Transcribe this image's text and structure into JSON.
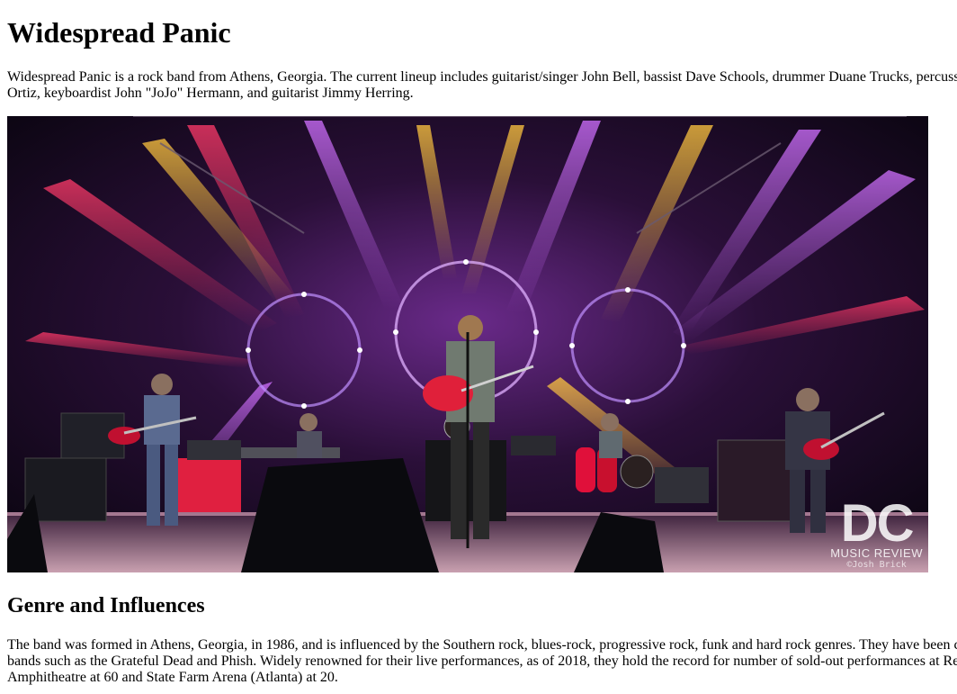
{
  "article": {
    "title": "Widespread Panic",
    "intro": "Widespread Panic is a rock band from Athens, Georgia. The current lineup includes guitarist/singer John Bell, bassist Dave Schools, drummer Duane Trucks, percussionist Domingo S. Ortiz, keyboardist John \"JoJo\" Hermann, and guitarist Jimmy Herring.",
    "section_heading": "Genre and Influences",
    "section_text": "The band was formed in Athens, Georgia, in 1986, and is influenced by the Southern rock, blues-rock, progressive rock, funk and hard rock genres. They have been compared to jam bands such as the Grateful Dead and Phish. Widely renowned for their live performances, as of 2018, they hold the record for number of sold-out performances at Red Rocks Amphitheatre at 60 and State Farm Arena (Atlanta) at 20."
  },
  "photo": {
    "watermark_logo": "DC",
    "watermark_sub": "MUSIC REVIEW",
    "watermark_credit": "©Josh Brick"
  }
}
